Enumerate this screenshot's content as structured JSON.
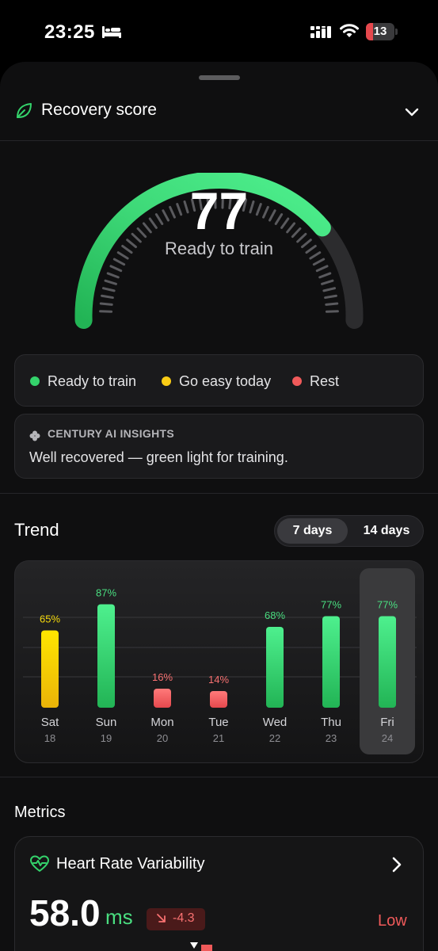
{
  "status_bar": {
    "time": "23:25",
    "battery": "13"
  },
  "header": {
    "title": "Recovery score"
  },
  "gauge": {
    "value": "77",
    "label": "Ready to train",
    "level": 0.77
  },
  "legend": [
    {
      "label": "Ready to train",
      "color": "#34d36b"
    },
    {
      "label": "Go easy today",
      "color": "#facc15"
    },
    {
      "label": "Rest",
      "color": "#f05a5a"
    }
  ],
  "insights": {
    "title": "CENTURY AI INSIGHTS",
    "text": "Well recovered — green light for training."
  },
  "trend": {
    "title": "Trend",
    "options": [
      "7 days",
      "14 days"
    ],
    "active_option": "7 days"
  },
  "chart_data": {
    "type": "bar",
    "categories": [
      "Sat",
      "Sun",
      "Mon",
      "Tue",
      "Wed",
      "Thu",
      "Fri"
    ],
    "dates": [
      "18",
      "19",
      "20",
      "21",
      "22",
      "23",
      "24"
    ],
    "values": [
      65,
      87,
      16,
      14,
      68,
      77,
      77
    ],
    "value_labels": [
      "65%",
      "87%",
      "16%",
      "14%",
      "68%",
      "77%",
      "77%"
    ],
    "bar_status": [
      "go-easy",
      "ready",
      "rest",
      "rest",
      "ready",
      "ready",
      "ready"
    ],
    "ylim": [
      0,
      100
    ],
    "grid": true,
    "selected": "Fri"
  },
  "metrics": {
    "title": "Metrics",
    "hrv": {
      "title": "Heart Rate Variability",
      "value": "58.0",
      "unit": "ms",
      "delta": "-4.3",
      "status": "Low"
    }
  }
}
